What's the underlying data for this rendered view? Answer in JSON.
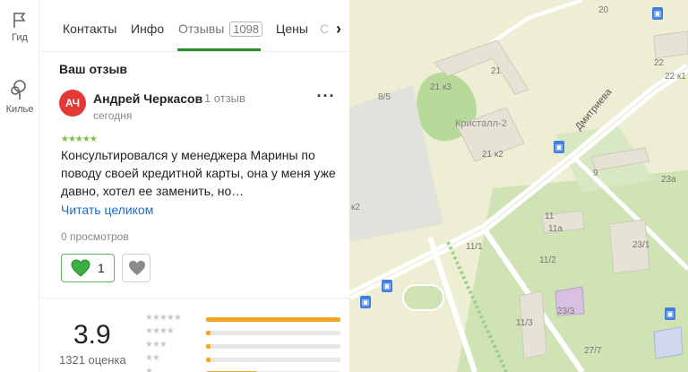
{
  "rail": {
    "items": [
      {
        "label": "Гид",
        "icon": "flag-icon"
      },
      {
        "label": "Килье",
        "icon": "tree-icon"
      }
    ]
  },
  "tabs": [
    {
      "label": "Контакты"
    },
    {
      "label": "Инфо"
    },
    {
      "label": "Отзывы",
      "count": "1098",
      "active": true
    },
    {
      "label": "Цены"
    },
    {
      "label": "С"
    }
  ],
  "review": {
    "section_title": "Ваш отзыв",
    "avatar_initials": "АЧ",
    "avatar_color": "#e53935",
    "author": "Андрей Черкасов",
    "author_reviews": "1 отзыв",
    "date": "сегодня",
    "stars": 5,
    "text": "Консультировался у менеджера Марины по поводу своей кредитной карты, она у меня уже давно, хотел ее заменить, но…",
    "read_more": "Читать целиком",
    "views": "0 просмотров",
    "likes": "1"
  },
  "rating": {
    "value": "3.9",
    "count": "1321 оценка",
    "distribution": [
      {
        "stars": 5,
        "fraction": 1.0
      },
      {
        "stars": 4,
        "fraction": 0.03
      },
      {
        "stars": 3,
        "fraction": 0.03
      },
      {
        "stars": 2,
        "fraction": 0.03
      },
      {
        "stars": 1,
        "fraction": 0.38
      }
    ]
  },
  "map": {
    "street": "Дмитриева",
    "place": "Кристалл-2",
    "labels": [
      "20",
      "22",
      "22 к1",
      "21",
      "21 к3",
      "8/5",
      "21 к2",
      "9",
      "23а",
      "11",
      "11а",
      "11/1",
      "11/2",
      "23/1",
      "23/3",
      "11/3",
      "27/7",
      "к2"
    ]
  },
  "colors": {
    "accent_green": "#2d8b2d",
    "link": "#1a6fc9",
    "star_green": "#7cc043",
    "bar_orange": "#f5a623"
  }
}
